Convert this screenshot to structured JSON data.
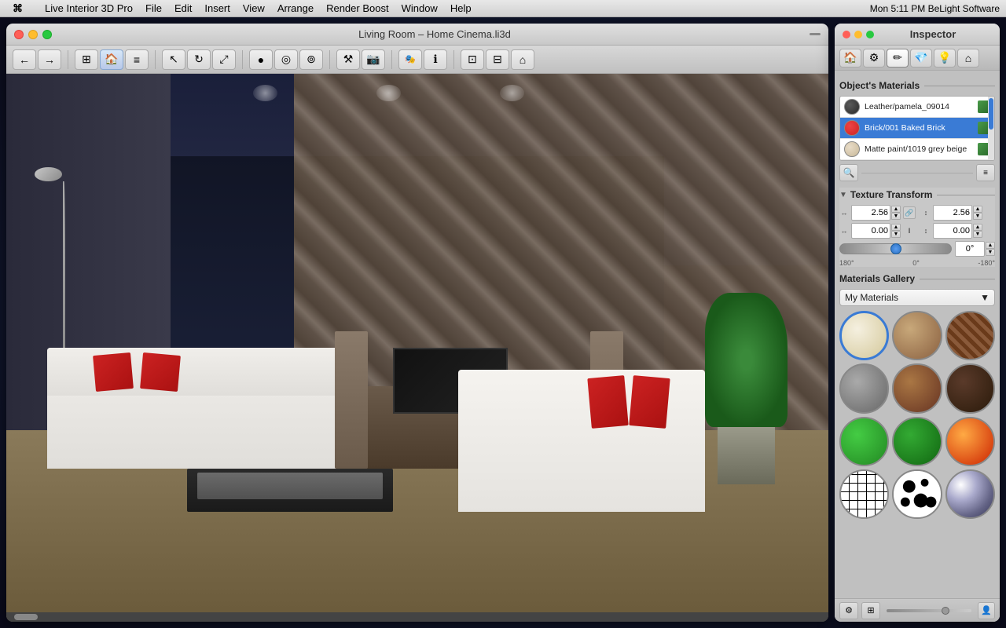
{
  "menubar": {
    "apple": "⌘",
    "items": [
      "Live Interior 3D Pro",
      "File",
      "Edit",
      "Insert",
      "View",
      "Arrange",
      "Render Boost",
      "Window",
      "Help"
    ],
    "right": "Mon 5:11 PM   BeLight Software"
  },
  "window": {
    "title": "Living Room – Home Cinema.li3d",
    "traffic": [
      "close",
      "minimize",
      "maximize"
    ]
  },
  "toolbar": {
    "buttons": [
      "←",
      "→",
      "⊞",
      "✕",
      "↩",
      "⊕",
      "✦",
      "◉",
      "◎",
      "⊚",
      "⚒",
      "📷",
      "🎭",
      "ℹ",
      "⊡",
      "⊟",
      "⌂"
    ]
  },
  "inspector": {
    "title": "Inspector",
    "tabs": [
      "🏠",
      "⚙",
      "✏",
      "💎",
      "💡",
      "🏠"
    ],
    "sections": {
      "objects_materials": {
        "label": "Object's Materials",
        "materials": [
          {
            "name": "Leather/pamela_09014",
            "color": "#3a3a3a",
            "selected": false
          },
          {
            "name": "Brick/001 Baked Brick",
            "color": "#cc3333",
            "selected": true
          },
          {
            "name": "Matte paint/1019 grey beige",
            "color": "#d4c8b0",
            "selected": false
          }
        ]
      },
      "texture_transform": {
        "label": "Texture Transform",
        "scale_x": "2.56",
        "scale_y": "2.56",
        "offset_x": "0.00",
        "offset_y": "0.00",
        "rotation": "0°",
        "slider_min": "180°",
        "slider_mid": "0°",
        "slider_max": "-180°"
      },
      "materials_gallery": {
        "label": "Materials Gallery",
        "dropdown_value": "My Materials",
        "items": [
          {
            "id": 0,
            "type": "cream",
            "selected": true
          },
          {
            "id": 1,
            "type": "wood-light",
            "selected": false
          },
          {
            "id": 2,
            "type": "brick",
            "selected": false
          },
          {
            "id": 3,
            "type": "stone-gray",
            "selected": false
          },
          {
            "id": 4,
            "type": "wood-dark-warm",
            "selected": false
          },
          {
            "id": 5,
            "type": "dark-brown",
            "selected": false
          },
          {
            "id": 6,
            "type": "green-bright",
            "selected": false
          },
          {
            "id": 7,
            "type": "green-deep",
            "selected": false
          },
          {
            "id": 8,
            "type": "fire-red",
            "selected": false
          },
          {
            "id": 9,
            "type": "zebra",
            "selected": false
          },
          {
            "id": 10,
            "type": "spots",
            "selected": false
          },
          {
            "id": 11,
            "type": "chrome",
            "selected": false
          }
        ]
      }
    }
  }
}
